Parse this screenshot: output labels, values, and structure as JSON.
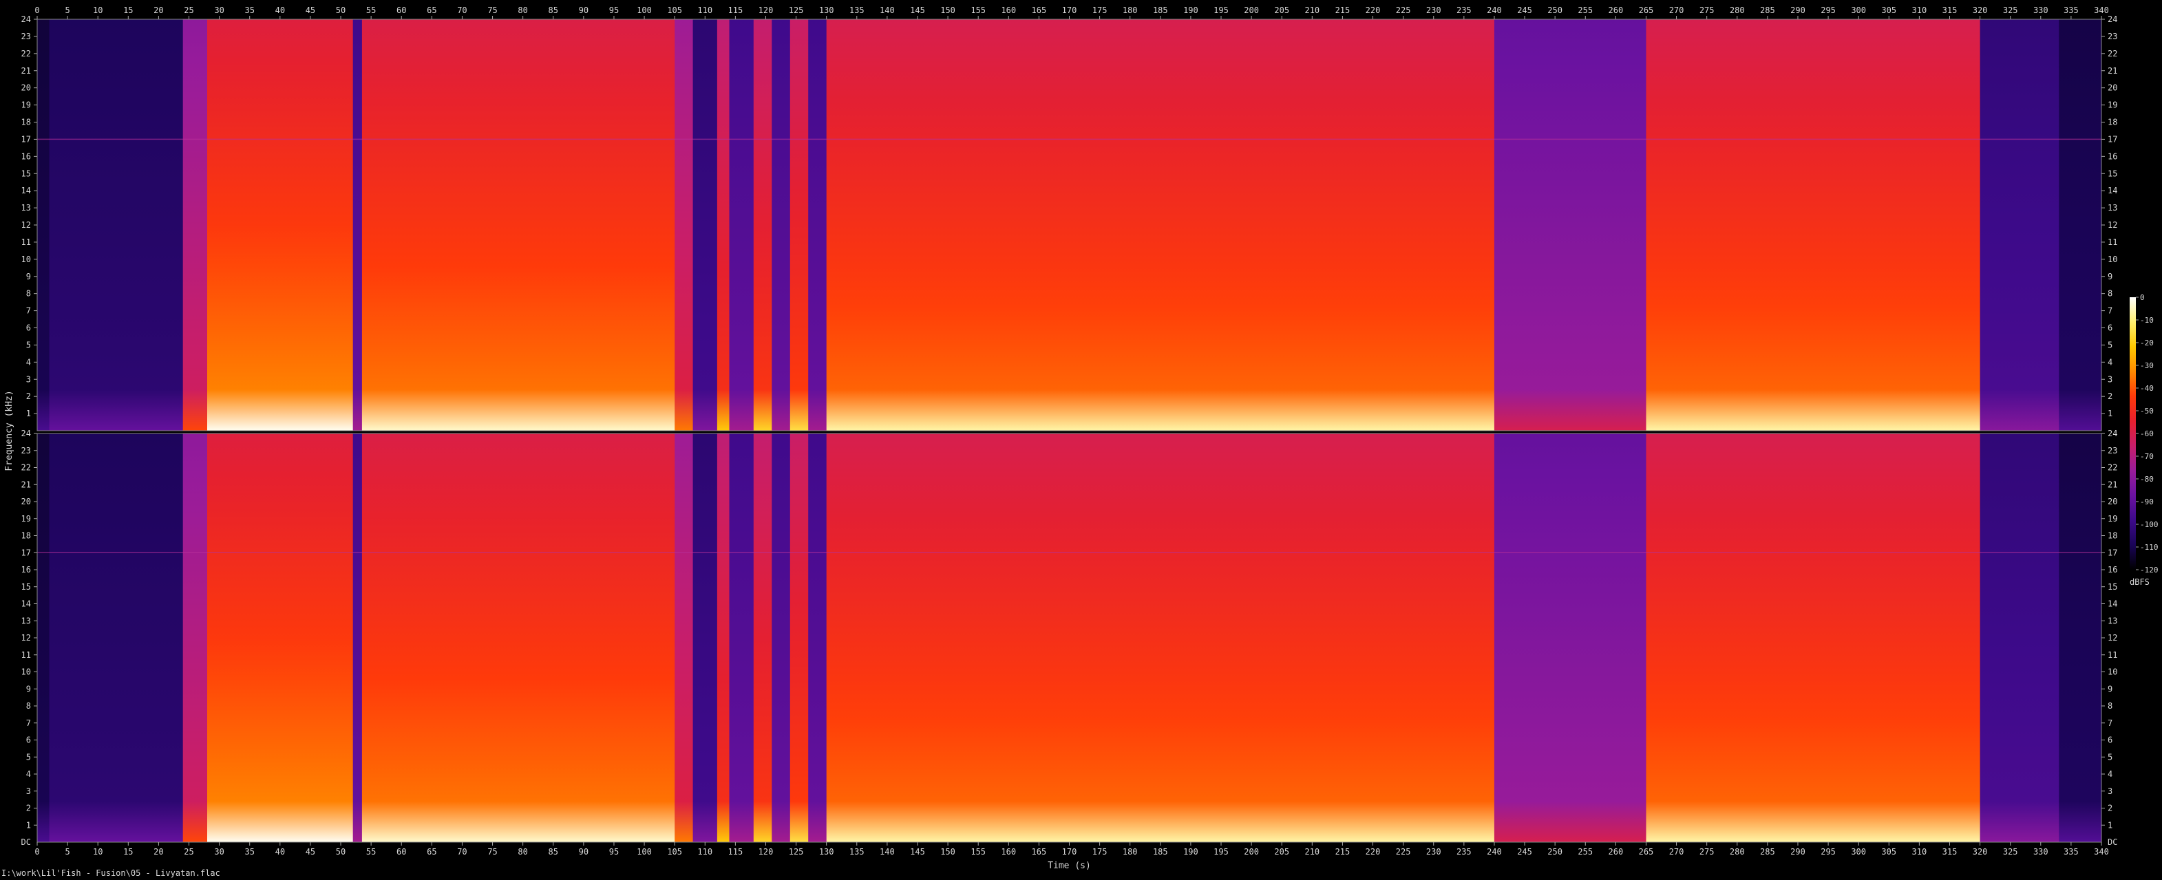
{
  "file_caption": "I:\\work\\Lil'Fish - Fusion\\05 - Livyatan.flac",
  "chart_data": {
    "type": "heatmap",
    "subtype": "spectrogram",
    "channels": 2,
    "xlabel": "Time (s)",
    "ylabel": "Frequency (kHz)",
    "xlim": [
      0,
      340
    ],
    "ylim": [
      0,
      24
    ],
    "x_ticks": [
      0,
      5,
      10,
      15,
      20,
      25,
      30,
      35,
      40,
      45,
      50,
      55,
      60,
      65,
      70,
      75,
      80,
      85,
      90,
      95,
      100,
      105,
      110,
      115,
      120,
      125,
      130,
      135,
      140,
      145,
      150,
      155,
      160,
      165,
      170,
      175,
      180,
      185,
      190,
      195,
      200,
      205,
      210,
      215,
      220,
      225,
      230,
      235,
      240,
      245,
      250,
      255,
      260,
      265,
      270,
      275,
      280,
      285,
      290,
      295,
      300,
      305,
      310,
      315,
      320,
      325,
      330,
      335,
      340
    ],
    "y_ticks": [
      1,
      2,
      3,
      4,
      5,
      6,
      7,
      8,
      9,
      10,
      11,
      12,
      13,
      14,
      15,
      16,
      17,
      18,
      19,
      20,
      21,
      22,
      23,
      24
    ],
    "y_zero_label": "DC",
    "colorbar": {
      "label": "dBFS",
      "ticks": [
        0,
        -10,
        -20,
        -30,
        -40,
        -50,
        -60,
        -70,
        -80,
        -90,
        -100,
        -110,
        -120
      ],
      "range": [
        -120,
        0
      ],
      "colors": [
        "#000000",
        "#1a0457",
        "#3d0a8a",
        "#6b12a0",
        "#9a1c9a",
        "#c81e6a",
        "#e6202e",
        "#ff3a0a",
        "#ff8a00",
        "#ffc800",
        "#fff070",
        "#ffffff"
      ]
    },
    "segments": [
      {
        "t": [
          0,
          2
        ],
        "level": 0.1
      },
      {
        "t": [
          2,
          24
        ],
        "level": 0.16
      },
      {
        "t": [
          24,
          28
        ],
        "level": 0.55
      },
      {
        "t": [
          28,
          52
        ],
        "level": 0.84
      },
      {
        "t": [
          52,
          53.5
        ],
        "level": 0.3
      },
      {
        "t": [
          53.5,
          105
        ],
        "level": 0.82
      },
      {
        "t": [
          105,
          108
        ],
        "level": 0.6
      },
      {
        "t": [
          108,
          112
        ],
        "level": 0.22
      },
      {
        "t": [
          112,
          114
        ],
        "level": 0.7
      },
      {
        "t": [
          114,
          118
        ],
        "level": 0.3
      },
      {
        "t": [
          118,
          121
        ],
        "level": 0.72
      },
      {
        "t": [
          121,
          124
        ],
        "level": 0.3
      },
      {
        "t": [
          124,
          127
        ],
        "level": 0.74
      },
      {
        "t": [
          127,
          130
        ],
        "level": 0.3
      },
      {
        "t": [
          130,
          240
        ],
        "level": 0.8
      },
      {
        "t": [
          240,
          265
        ],
        "level": 0.42
      },
      {
        "t": [
          265,
          320
        ],
        "level": 0.8
      },
      {
        "t": [
          320,
          333
        ],
        "level": 0.24
      },
      {
        "t": [
          333,
          340
        ],
        "level": 0.12
      }
    ],
    "reference_line_khz": 17
  }
}
